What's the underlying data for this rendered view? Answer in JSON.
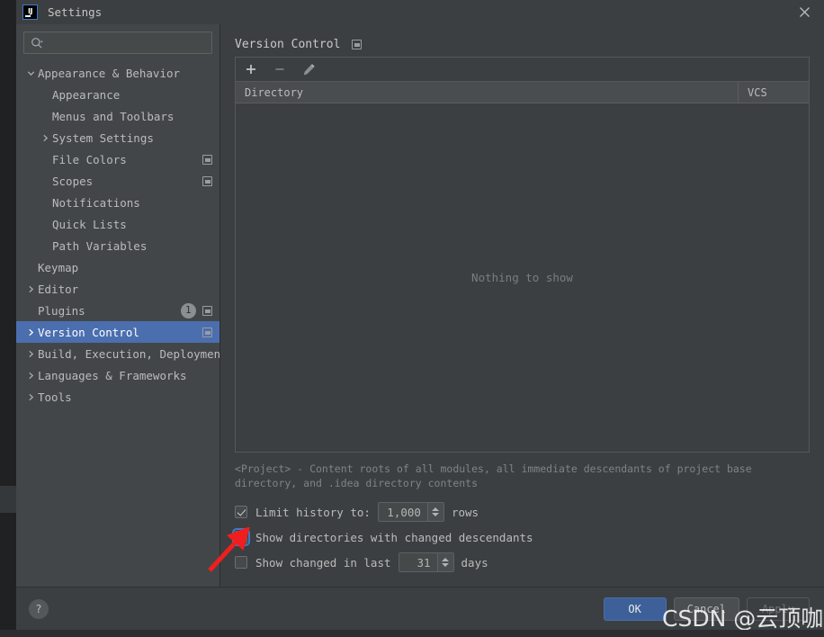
{
  "window": {
    "title": "Settings",
    "logo_text": "IJ",
    "close_icon": "close-icon"
  },
  "search": {
    "value": "",
    "placeholder": "",
    "icon": "search-icon"
  },
  "sidebar": {
    "items": [
      {
        "label": "Appearance & Behavior",
        "indent": 0,
        "twisty": "expanded",
        "selected": false,
        "badge": null,
        "window_icon": false
      },
      {
        "label": "Appearance",
        "indent": 1,
        "twisty": "none",
        "selected": false,
        "badge": null,
        "window_icon": false
      },
      {
        "label": "Menus and Toolbars",
        "indent": 1,
        "twisty": "none",
        "selected": false,
        "badge": null,
        "window_icon": false
      },
      {
        "label": "System Settings",
        "indent": 1,
        "twisty": "collapsed",
        "selected": false,
        "badge": null,
        "window_icon": false
      },
      {
        "label": "File Colors",
        "indent": 1,
        "twisty": "none",
        "selected": false,
        "badge": null,
        "window_icon": true
      },
      {
        "label": "Scopes",
        "indent": 1,
        "twisty": "none",
        "selected": false,
        "badge": null,
        "window_icon": true
      },
      {
        "label": "Notifications",
        "indent": 1,
        "twisty": "none",
        "selected": false,
        "badge": null,
        "window_icon": false
      },
      {
        "label": "Quick Lists",
        "indent": 1,
        "twisty": "none",
        "selected": false,
        "badge": null,
        "window_icon": false
      },
      {
        "label": "Path Variables",
        "indent": 1,
        "twisty": "none",
        "selected": false,
        "badge": null,
        "window_icon": false
      },
      {
        "label": "Keymap",
        "indent": 0,
        "twisty": "none",
        "selected": false,
        "badge": null,
        "window_icon": false
      },
      {
        "label": "Editor",
        "indent": 0,
        "twisty": "collapsed",
        "selected": false,
        "badge": null,
        "window_icon": false
      },
      {
        "label": "Plugins",
        "indent": 0,
        "twisty": "none",
        "selected": false,
        "badge": "1",
        "window_icon": true
      },
      {
        "label": "Version Control",
        "indent": 0,
        "twisty": "collapsed",
        "selected": true,
        "badge": null,
        "window_icon": true
      },
      {
        "label": "Build, Execution, Deployment",
        "indent": 0,
        "twisty": "collapsed",
        "selected": false,
        "badge": null,
        "window_icon": false
      },
      {
        "label": "Languages & Frameworks",
        "indent": 0,
        "twisty": "collapsed",
        "selected": false,
        "badge": null,
        "window_icon": false
      },
      {
        "label": "Tools",
        "indent": 0,
        "twisty": "collapsed",
        "selected": false,
        "badge": null,
        "window_icon": false
      }
    ]
  },
  "content": {
    "title": "Version Control",
    "toolbar": {
      "add_label": "+",
      "remove_label": "−",
      "edit_label": "edit"
    },
    "table": {
      "columns": [
        "Directory",
        "VCS"
      ],
      "rows": [],
      "empty_text": "Nothing to show"
    },
    "description": "<Project> - Content roots of all modules, all immediate descendants of project base directory, and .idea directory contents",
    "options": [
      {
        "label": "Limit history to:",
        "checked": true,
        "focused": false,
        "value": "1,000",
        "suffix": "rows",
        "has_spinner": true
      },
      {
        "label": "Show directories with changed descendants",
        "checked": true,
        "focused": true,
        "value": null,
        "suffix": null,
        "has_spinner": false
      },
      {
        "label": "Show changed in last",
        "checked": false,
        "focused": false,
        "value": "31",
        "suffix": "days",
        "has_spinner": true
      }
    ]
  },
  "footer": {
    "help_label": "?",
    "ok_label": "OK",
    "cancel_label": "Cancel",
    "apply_label": "Apply"
  },
  "annotations": {
    "watermark": "CSDN @云顶咖啡",
    "arrow_color": "#f01e1e"
  },
  "colors": {
    "accent": "#4b6eaf",
    "dialog_bg": "#3c3f41",
    "sidebar_bg": "#434649",
    "focus_ring": "#3e79c9",
    "primary_button": "#3c6097"
  }
}
